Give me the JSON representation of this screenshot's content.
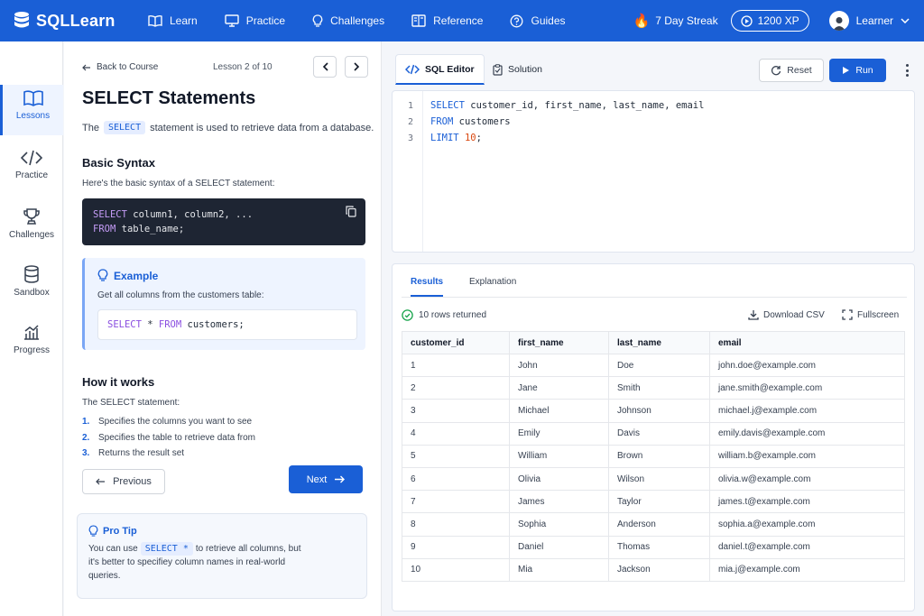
{
  "app": {
    "name": "SQLLearn"
  },
  "nav": {
    "items": [
      {
        "label": "Learn",
        "icon": "book-icon"
      },
      {
        "label": "Practice",
        "icon": "monitor-icon"
      },
      {
        "label": "Challenges",
        "icon": "lightbulb-icon"
      },
      {
        "label": "Reference",
        "icon": "open-book-icon"
      },
      {
        "label": "Guides",
        "icon": "help-circle-icon"
      }
    ],
    "streak": "7 Day Streak",
    "xp": "1200 XP",
    "user": "Learner"
  },
  "rail": {
    "items": [
      {
        "label": "Lessons",
        "icon": "book-icon",
        "active": true
      },
      {
        "label": "Practice",
        "icon": "code-icon"
      },
      {
        "label": "Challenges",
        "icon": "trophy-icon"
      },
      {
        "label": "Sandbox",
        "icon": "database-icon"
      },
      {
        "label": "Progress",
        "icon": "chart-icon"
      }
    ]
  },
  "lesson": {
    "back": "Back to Course",
    "count": "Lesson 2 of 10",
    "title": "SELECT Statements",
    "intro_pre": "The",
    "intro_kw": "SELECT",
    "intro_post": "statement is used to retrieve data from a database.",
    "syntax_heading": "Basic Syntax",
    "syntax_desc": "Here's the basic syntax of a SELECT statement:",
    "syntax_code": {
      "line1_kw": "SELECT",
      "line1_rest": " column1, column2, ...",
      "line2_kw": "FROM",
      "line2_rest": " table_name;"
    },
    "example": {
      "title": "Example",
      "desc": "Get all columns from the customers table:",
      "code_kw1": "SELECT",
      "code_mid": " * ",
      "code_kw2": "FROM",
      "code_rest": " customers;"
    },
    "how_heading": "How it works",
    "how_desc": "The SELECT statement:",
    "steps": [
      {
        "num": "1.",
        "text": "Specifies the columns you want to see"
      },
      {
        "num": "2.",
        "text": "Specifies the table to retrieve data from"
      },
      {
        "num": "3.",
        "text": "Returns the result set"
      }
    ],
    "prev": "Previous",
    "next": "Next",
    "protip": {
      "title": "Pro Tip",
      "pre": "You can use",
      "kw": "SELECT *",
      "post": "to retrieve all columns, but it's better to specifiey column names in real-world queries."
    }
  },
  "editor": {
    "tab_editor": "SQL Editor",
    "tab_solution": "Solution",
    "reset": "Reset",
    "run": "Run",
    "lines": [
      {
        "num": "1",
        "kw": "SELECT",
        "rest": " customer_id, first_name, last_name, email"
      },
      {
        "num": "2",
        "kw": "FROM",
        "rest": " customers"
      },
      {
        "num": "3",
        "kw": "LIMIT",
        "num_val": "10",
        "end": ";"
      }
    ]
  },
  "results": {
    "tab_results": "Results",
    "tab_explanation": "Explanation",
    "rows_returned": "10 rows returned",
    "download": "Download CSV",
    "fullscreen": "Fullscreen",
    "columns": [
      "customer_id",
      "first_name",
      "last_name",
      "email"
    ],
    "rows": [
      [
        "1",
        "John",
        "Doe",
        "john.doe@example.com"
      ],
      [
        "2",
        "Jane",
        "Smith",
        "jane.smith@example.com"
      ],
      [
        "3",
        "Michael",
        "Johnson",
        "michael.j@example.com"
      ],
      [
        "4",
        "Emily",
        "Davis",
        "emily.davis@example.com"
      ],
      [
        "5",
        "William",
        "Brown",
        "william.b@example.com"
      ],
      [
        "6",
        "Olivia",
        "Wilson",
        "olivia.w@example.com"
      ],
      [
        "7",
        "James",
        "Taylor",
        "james.t@example.com"
      ],
      [
        "8",
        "Sophia",
        "Anderson",
        "sophia.a@example.com"
      ],
      [
        "9",
        "Daniel",
        "Thomas",
        "daniel.t@example.com"
      ],
      [
        "10",
        "Mia",
        "Jackson",
        "mia.j@example.com"
      ]
    ]
  }
}
